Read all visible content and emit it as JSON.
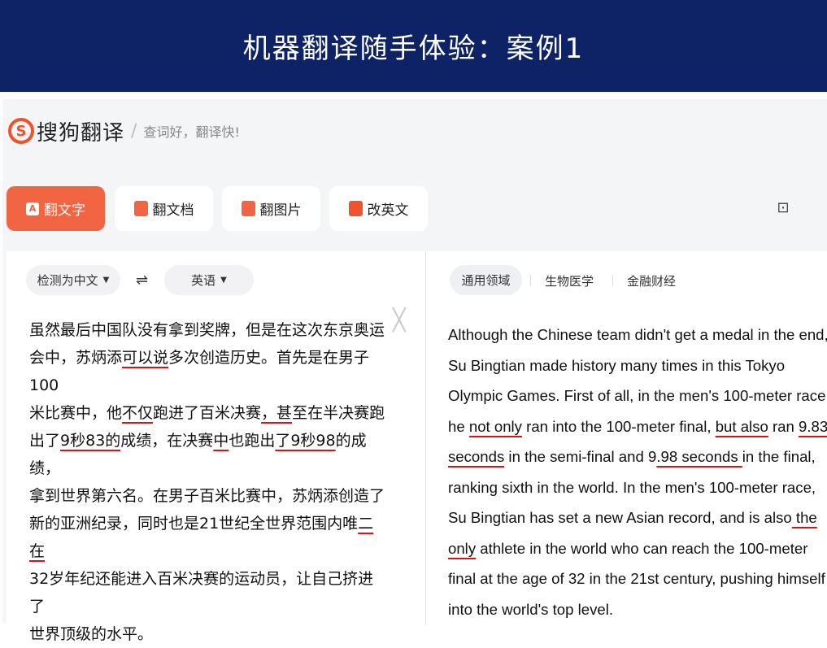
{
  "banner": {
    "title": "机器翻译随手体验：案例1"
  },
  "brand": {
    "logo_letter": "S",
    "name": "搜狗翻译",
    "separator": "/",
    "slogan": "查词好，翻译快!"
  },
  "tabs": [
    {
      "label": "翻文字",
      "icon": "text-translate-icon",
      "icon_glyph": "A",
      "active": true
    },
    {
      "label": "翻文档",
      "icon": "document-icon",
      "icon_glyph": "",
      "active": false
    },
    {
      "label": "翻图片",
      "icon": "image-icon",
      "icon_glyph": "",
      "active": false
    },
    {
      "label": "改英文",
      "icon": "edit-english-icon",
      "icon_glyph": "",
      "active": false
    }
  ],
  "toolbar_right": {
    "icon": "favorites-icon",
    "glyph": "⊡"
  },
  "source": {
    "detected_lang": "检测为中文",
    "swap_glyph": "⇌",
    "target_lang": "英语",
    "close_glyph": "╳",
    "lines": [
      "虽然最后中国队没有拿到奖牌，但是在这次东京奥运",
      "会中，苏炳添可以说多次创造历史。首先是在男子100",
      "米比赛中，他不仅跑进了百米决赛，甚至在半决赛跑",
      "出了9秒83的成绩，在决赛中也跑出了9秒98的成绩，",
      "拿到世界第六名。在男子百米比赛中，苏炳添创造了",
      "新的亚洲纪录，同时也是21世纪全世界范围内唯二在",
      "32岁年纪还能进入百米决赛的运动员，让自己挤进了",
      "世界顶级的水平。"
    ]
  },
  "target": {
    "domains": [
      "通用领域",
      "生物医学",
      "金融财经"
    ],
    "lines": [
      "Although the Chinese team didn't get a medal in the end,",
      "Su Bingtian made history many times in this Tokyo",
      "Olympic Games. First of all, in the men's 100-meter race,",
      "he not only ran into the 100-meter final, but also ran 9.83",
      "seconds in the semi-final and 9.98 seconds in the final,",
      "ranking sixth in the world. In the men's 100-meter race,",
      "Su Bingtian has set a new Asian record, and is also the",
      "only athlete in the world who can reach the 100-meter",
      "final at the age of 32 in the 21st century, pushing himself",
      "into the world's top level."
    ]
  },
  "colors": {
    "banner": "#0d2366",
    "accent": "#f26542",
    "underline": "#d8121b"
  }
}
